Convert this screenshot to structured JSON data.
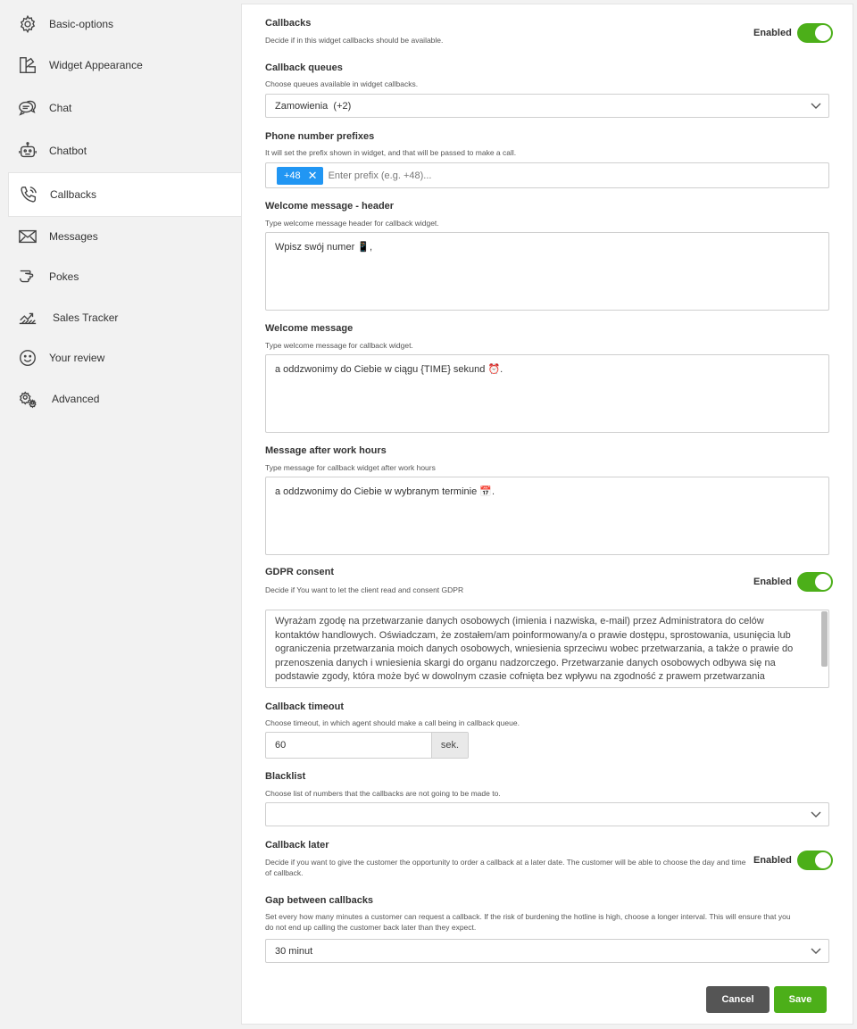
{
  "sidebar": {
    "items": [
      {
        "label": "Basic-options",
        "icon": "gear-icon"
      },
      {
        "label": "Widget Appearance",
        "icon": "palette-icon"
      },
      {
        "label": "Chat",
        "icon": "chat-bubbles-icon"
      },
      {
        "label": "Chatbot",
        "icon": "robot-icon"
      },
      {
        "label": "Callbacks",
        "icon": "phone-ring-icon",
        "active": true
      },
      {
        "label": "Messages",
        "icon": "envelope-icon"
      },
      {
        "label": "Pokes",
        "icon": "pointing-hand-icon"
      },
      {
        "label": "Sales Tracker",
        "icon": "sales-chart-icon"
      },
      {
        "label": "Your review",
        "icon": "smiley-icon"
      },
      {
        "label": "Advanced",
        "icon": "gears-icon"
      }
    ]
  },
  "callbacks": {
    "title": "Callbacks",
    "desc": "Decide if in this widget callbacks should be available.",
    "toggle_label": "Enabled"
  },
  "queues": {
    "title": "Callback queues",
    "desc": "Choose queues available in widget callbacks.",
    "value": "Zamowienia  (+2)"
  },
  "prefixes": {
    "title": "Phone number prefixes",
    "desc": "It will set the prefix shown in widget, and that will be passed to make a call.",
    "chip": "+48",
    "chip_remove": "✕",
    "placeholder": "Enter prefix (e.g. +48)..."
  },
  "welcome_header": {
    "title": "Welcome message - header",
    "desc": "Type welcome message header for callback widget.",
    "value": "Wpisz swój numer 📱,"
  },
  "welcome_message": {
    "title": "Welcome message",
    "desc": "Type welcome message for callback widget.",
    "value": "a oddzwonimy do Ciebie w ciągu {TIME} sekund ⏰."
  },
  "after_hours": {
    "title": "Message after work hours",
    "desc": "Type message for callback widget after work hours",
    "value": "a oddzwonimy do Ciebie w wybranym terminie 📅."
  },
  "gdpr": {
    "title": "GDPR consent",
    "desc": "Decide if You want to let the client read and consent GDPR",
    "toggle_label": "Enabled",
    "text": "Wyrażam zgodę na przetwarzanie danych osobowych (imienia i nazwiska, e-mail) przez Administratora do celów kontaktów handlowych. Oświadczam, że zostałem/am poinformowany/a o prawie dostępu, sprostowania, usunięcia lub ograniczenia przetwarzania moich danych osobowych, wniesienia sprzeciwu wobec przetwarzania, a także o prawie do przenoszenia danych i wniesienia skargi do organu nadzorczego. Przetwarzanie danych osobowych odbywa się na podstawie zgody, która może być w dowolnym czasie cofnięta bez wpływu na zgodność z prawem przetwarzania"
  },
  "timeout": {
    "title": "Callback timeout",
    "desc": "Choose timeout, in which agent should make a call being in callback queue.",
    "value": "60",
    "unit": "sek."
  },
  "blacklist": {
    "title": "Blacklist",
    "desc": "Choose list of numbers that the callbacks are not going to be made to.",
    "value": ""
  },
  "callback_later": {
    "title": "Callback later",
    "desc": "Decide if you want to give the customer the opportunity to order a callback at a later date. The customer will be able to choose the day and time of callback.",
    "toggle_label": "Enabled"
  },
  "gap": {
    "title": "Gap between callbacks",
    "desc": "Set every how many minutes a customer can request a callback. If the risk of burdening the hotline is high, choose a longer interval. This will ensure that you do not end up calling the customer back later than they expect.",
    "value": "30 minut"
  },
  "actions": {
    "cancel": "Cancel",
    "save": "Save"
  },
  "colors": {
    "accent_green": "#4caf19",
    "chip_blue": "#2196f3",
    "cancel_gray": "#555555"
  }
}
